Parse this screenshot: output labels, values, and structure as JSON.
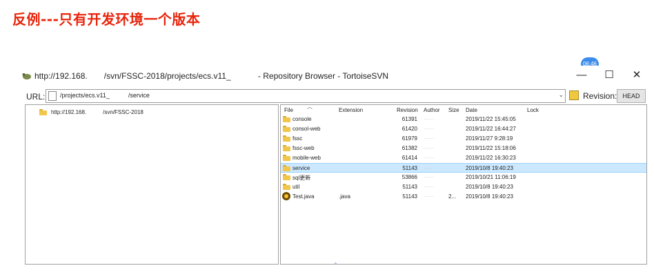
{
  "heading": "反例---只有开发环境一个版本",
  "badge": "06:46",
  "window": {
    "title": "http://192.168.  /svn/FSSC-2018/projects/ecs.v11_    - Repository Browser - TortoiseSVN",
    "buttons": {
      "minimize": "—",
      "maximize": "☐",
      "close": "✕"
    }
  },
  "urlbar": {
    "label": "URL:",
    "value": "/projects/ecs.v11_   /service",
    "dropdown": "⌄",
    "revision_label": "Revision:",
    "revision_button": "HEAD"
  },
  "tree": {
    "root": "http://192.168.   /svn/FSSC-2018"
  },
  "list": {
    "columns": [
      "File",
      "Extension",
      "Revision",
      "Author",
      "Size",
      "Date",
      "Lock"
    ],
    "sort_indicator": "︿",
    "rows": [
      {
        "icon": "folder",
        "name": "console",
        "ext": "",
        "rev": "61391",
        "author": "·····",
        "size": "",
        "date": "2019/11/22 15:45:05",
        "selected": false
      },
      {
        "icon": "folder",
        "name": "consol-web",
        "ext": "",
        "rev": "61420",
        "author": "·····",
        "size": "",
        "date": "2019/11/22 16:44:27",
        "selected": false
      },
      {
        "icon": "folder",
        "name": "fssc",
        "ext": "",
        "rev": "61979",
        "author": "·····",
        "size": "",
        "date": "2019/11/27 9:28:19",
        "selected": false
      },
      {
        "icon": "folder",
        "name": "fssc-web",
        "ext": "",
        "rev": "61382",
        "author": "·····",
        "size": "",
        "date": "2019/11/22 15:18:06",
        "selected": false
      },
      {
        "icon": "folder",
        "name": "mobile-web",
        "ext": "",
        "rev": "61414",
        "author": "·····",
        "size": "",
        "date": "2019/11/22 16:30:23",
        "selected": false
      },
      {
        "icon": "folder",
        "name": "service",
        "ext": "",
        "rev": "51143",
        "author": "·····",
        "size": "",
        "date": "2019/10/8 19:40:23",
        "selected": true
      },
      {
        "icon": "folder",
        "name": "sql更新",
        "ext": "",
        "rev": "53866",
        "author": "·····",
        "size": "",
        "date": "2019/10/21 11:06:19",
        "selected": false
      },
      {
        "icon": "folder",
        "name": "util",
        "ext": "",
        "rev": "51143",
        "author": "·····",
        "size": "",
        "date": "2019/10/8 19:40:23",
        "selected": false
      },
      {
        "icon": "java",
        "name": "Test.java",
        "ext": ".java",
        "rev": "51143",
        "author": "·····",
        "size": "2...",
        "date": "2019/10/8 19:40:23",
        "selected": false
      }
    ]
  }
}
